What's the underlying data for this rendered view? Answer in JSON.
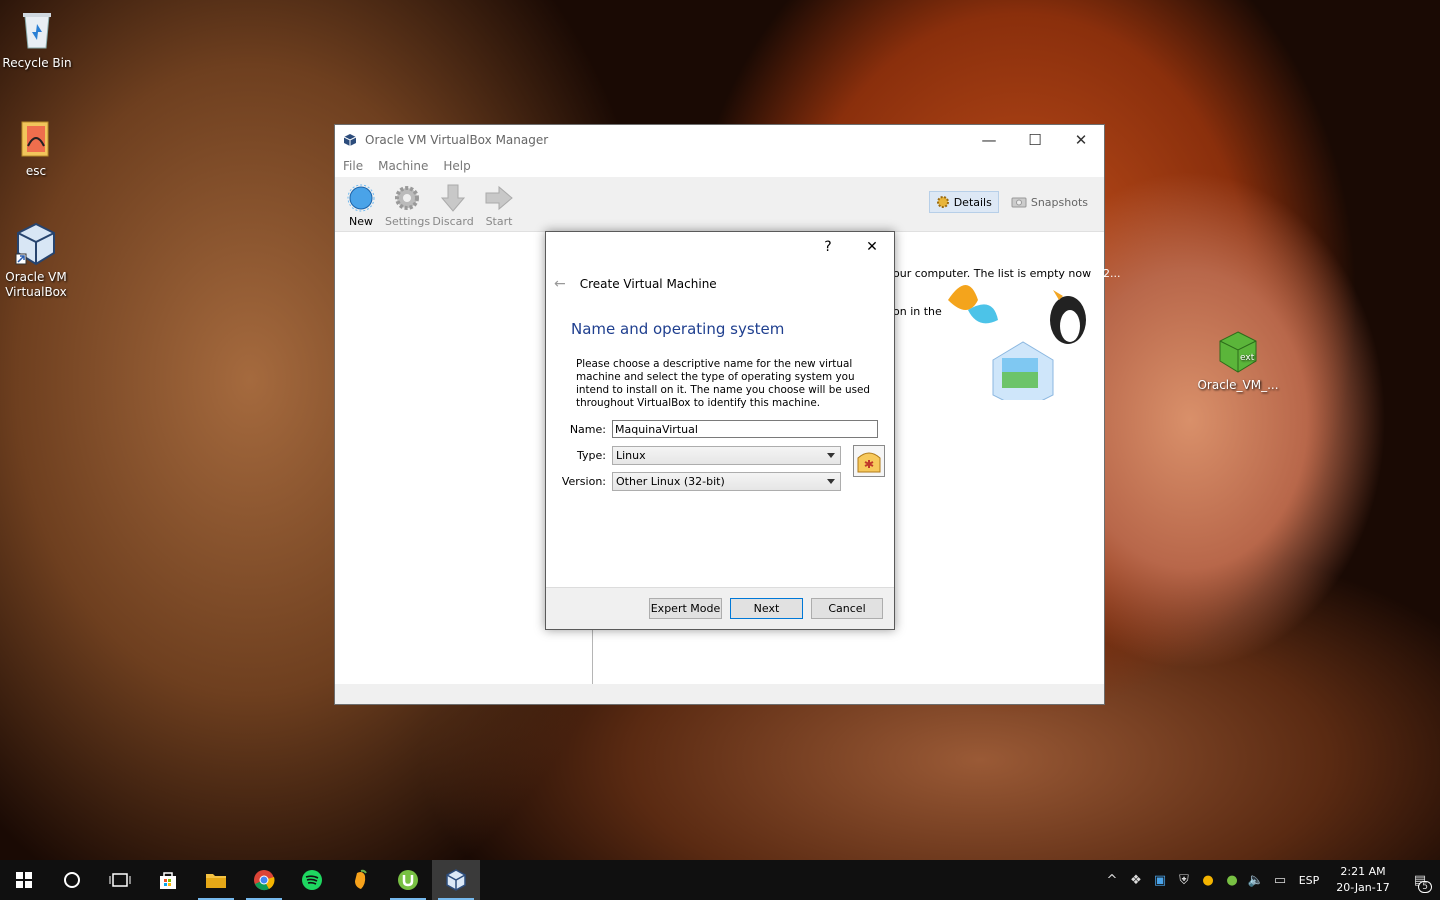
{
  "desktop": {
    "icons": [
      {
        "name": "recycle-bin",
        "label": "Recycle Bin"
      },
      {
        "name": "esc",
        "label": "esc"
      },
      {
        "name": "virtualbox",
        "label": "Oracle VM VirtualBox"
      },
      {
        "name": "extension-pack",
        "label": "Oracle_VM_..."
      }
    ]
  },
  "manager": {
    "title": "Oracle VM VirtualBox Manager",
    "menu": [
      "File",
      "Machine",
      "Help"
    ],
    "toolbar": {
      "new": "New",
      "settings": "Settings",
      "discard": "Discard",
      "start": "Start"
    },
    "tabs": {
      "details": "Details",
      "snapshots": "Snapshots"
    },
    "welcome_line1": "our computer. The list is empty now",
    "welcome_line1_suffix": "2...",
    "welcome_line2": "on in the"
  },
  "dialog": {
    "help_glyph": "?",
    "close_glyph": "✕",
    "back_glyph": "←",
    "header": "Create Virtual Machine",
    "subtitle": "Name and operating system",
    "description": "Please choose a descriptive name for the new virtual machine and select the type of operating system you intend to install on it. The name you choose will be used throughout VirtualBox to identify this machine.",
    "name_label": "Name:",
    "name_value": "MaquinaVirtual",
    "type_label": "Type:",
    "type_value": "Linux",
    "version_label": "Version:",
    "version_value": "Other Linux (32-bit)",
    "buttons": {
      "expert": "Expert Mode",
      "next": "Next",
      "cancel": "Cancel"
    }
  },
  "taskbar": {
    "apps": [
      "start-menu",
      "cortana",
      "task-view",
      "store",
      "file-explorer",
      "chrome",
      "spotify",
      "fl-studio",
      "utorrent",
      "virtualbox"
    ],
    "language": "ESP",
    "time": "2:21 AM",
    "date": "20-Jan-17",
    "notification_count": "5"
  },
  "colors": {
    "accent": "#0078d7",
    "subtitle": "#1f3f8f",
    "taskbar": "#101010"
  }
}
